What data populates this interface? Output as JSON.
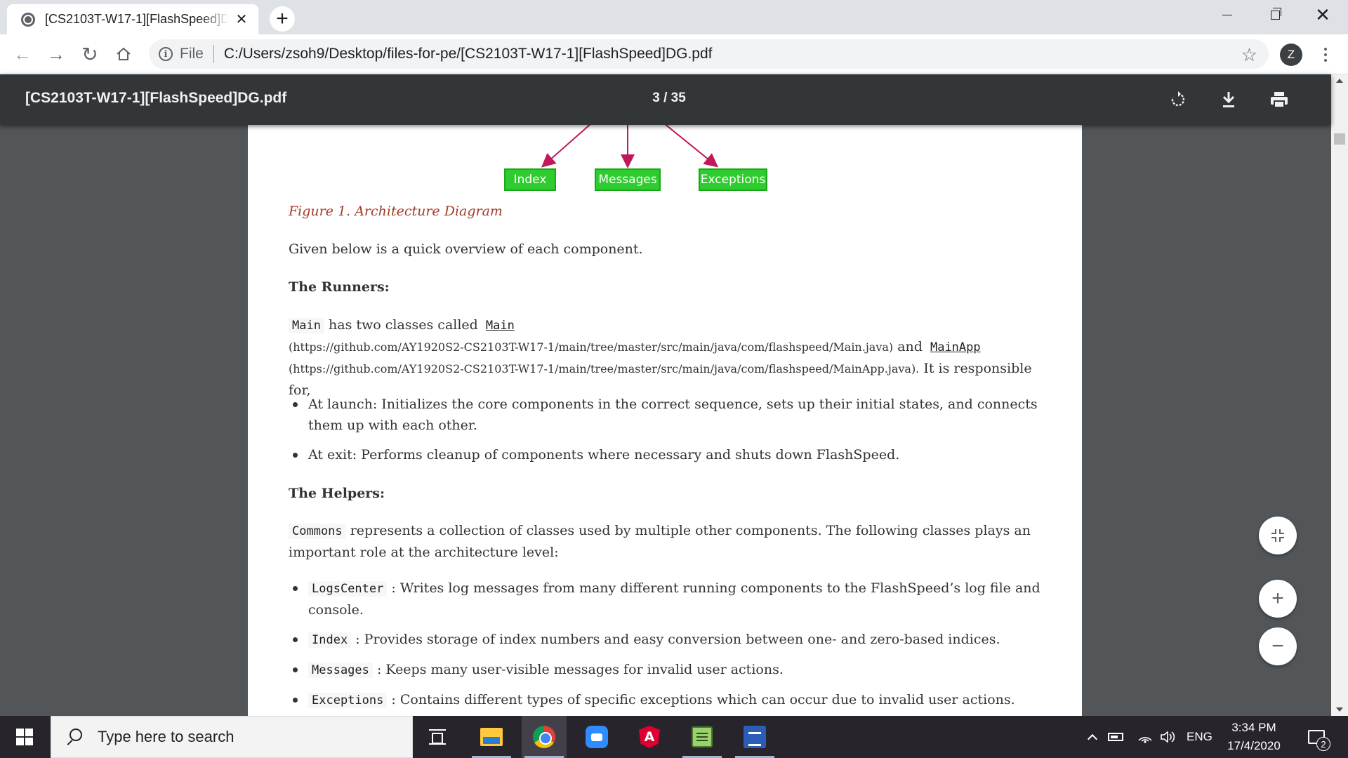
{
  "browser": {
    "tab_title": "[CS2103T-W17-1][FlashSpeed]DG.pdf",
    "scheme_label": "File",
    "url": "C:/Users/zsoh9/Desktop/files-for-pe/[CS2103T-W17-1][FlashSpeed]DG.pdf",
    "profile_initial": "Z"
  },
  "pdf_toolbar": {
    "title": "[CS2103T-W17-1][FlashSpeed]DG.pdf",
    "page_indicator": "3 / 35"
  },
  "diagram": {
    "boxes": [
      "Index",
      "Messages",
      "Exceptions"
    ],
    "box_color": "#2ecc2e",
    "arrow_color": "#c2185b"
  },
  "document": {
    "caption": "Figure 1. Architecture Diagram",
    "overview": "Given below is a quick overview of each component.",
    "runners_heading": "The Runners:",
    "runners": {
      "code_main": "Main",
      "text1": "has two classes called",
      "link_main": "Main",
      "url_main": "(https://github.com/AY1920S2-CS2103T-W17-1/main/tree/master/src/main/java/com/flashspeed/Main.java)",
      "and": "and",
      "link_mainapp": "MainApp",
      "url_mainapp": "(https://github.com/AY1920S2-CS2103T-W17-1/main/tree/master/src/main/java/com/flashspeed/MainApp.java).",
      "text2": "It is responsible for,"
    },
    "runner_bullets": [
      "At launch: Initializes the core components in the correct sequence, sets up their initial states, and connects them up with each other.",
      "At exit: Performs cleanup of components where necessary and shuts down FlashSpeed."
    ],
    "helpers_heading": "The Helpers:",
    "helpers": {
      "code_commons": "Commons",
      "text": "represents a collection of classes used by multiple other components. The following classes plays an important role at the architecture level:"
    },
    "helper_bullets": [
      {
        "code": "LogsCenter",
        "text": ": Writes log messages from many different running components to the FlashSpeed’s log file and console."
      },
      {
        "code": "Index",
        "text": ": Provides storage of index numbers and easy conversion between one- and zero-based indices."
      },
      {
        "code": "Messages",
        "text": ": Keeps many user-visible messages for invalid user actions."
      },
      {
        "code": "Exceptions",
        "text": ": Contains different types of specific exceptions which can occur due to invalid user actions."
      }
    ]
  },
  "taskbar": {
    "search_placeholder": "Type here to search",
    "language": "ENG",
    "time": "3:34 PM",
    "date": "17/4/2020",
    "notification_count": "2",
    "apps": [
      "task-view",
      "file-explorer",
      "chrome",
      "zoom",
      "angular",
      "notepad",
      "sourcetree"
    ]
  }
}
